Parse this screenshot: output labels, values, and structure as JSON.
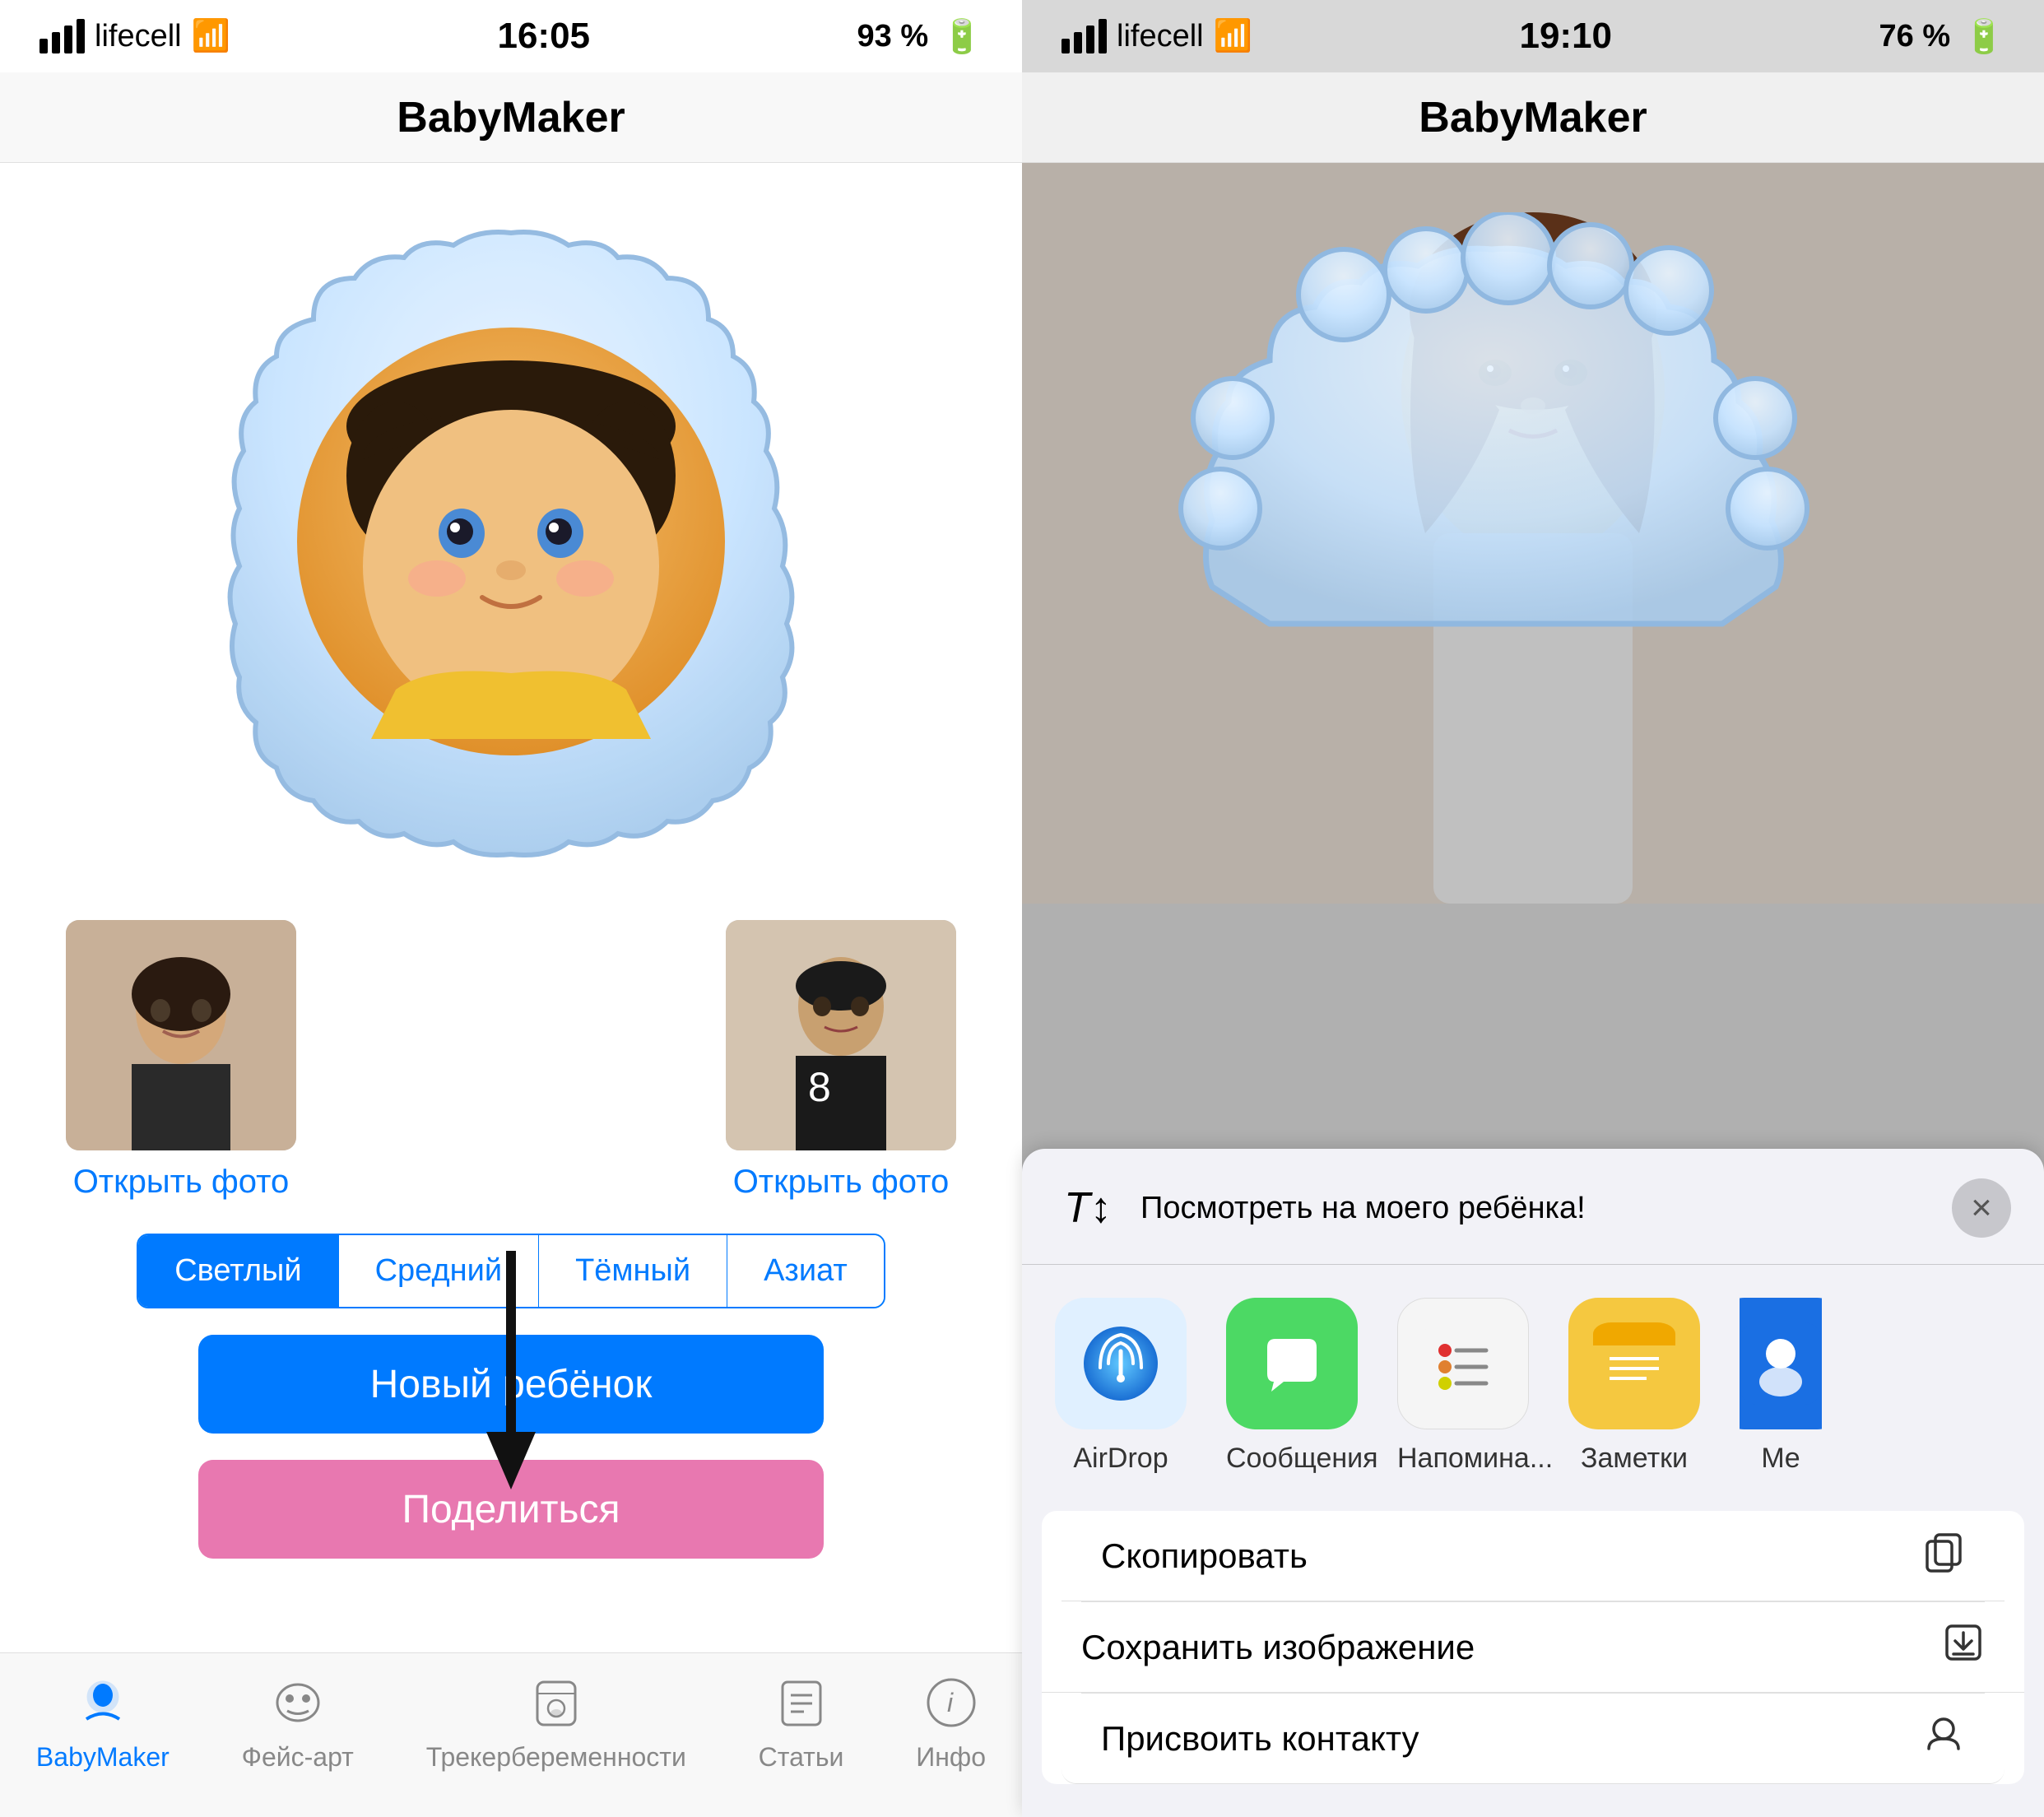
{
  "left": {
    "status": {
      "carrier": "lifecell",
      "time": "16:05",
      "battery": "93 %",
      "signal": 4,
      "wifi": true
    },
    "nav": {
      "title": "BabyMaker"
    },
    "skin_buttons": [
      {
        "label": "Светлый",
        "active": true
      },
      {
        "label": "Средний",
        "active": false
      },
      {
        "label": "Тёмный",
        "active": false
      },
      {
        "label": "Азиат",
        "active": false
      }
    ],
    "btn_new": "Новый ребёнок",
    "btn_share": "Поделиться",
    "open_photo_left": "Открыть фото",
    "open_photo_right": "Открыть фото",
    "tabs": [
      {
        "label": "BabyMaker",
        "active": true
      },
      {
        "label": "Фейс-арт",
        "active": false
      },
      {
        "label": "Трекербеременности",
        "active": false
      },
      {
        "label": "Статьи",
        "active": false
      },
      {
        "label": "Инфо",
        "active": false
      }
    ]
  },
  "right": {
    "status": {
      "carrier": "lifecell",
      "time": "19:10",
      "battery": "76 %",
      "signal": 4,
      "wifi": true
    },
    "nav": {
      "title": "BabyMaker"
    },
    "share_sheet": {
      "message": "Посмотреть на моего ребёнка!",
      "close_label": "×",
      "apps": [
        {
          "name": "AirDrop",
          "color": "#1a8fe3"
        },
        {
          "name": "Сообщения",
          "color": "#4cd964"
        },
        {
          "name": "Напомина...",
          "color": "#f5f5f5"
        },
        {
          "name": "Заметки",
          "color": "#f5c842"
        },
        {
          "name": "Me",
          "color": "#1a6fe3"
        }
      ],
      "actions": [
        {
          "label": "Скопировать",
          "icon": "⊞"
        },
        {
          "label": "Сохранить изображение",
          "icon": "⬇"
        },
        {
          "label": "Присвоить контакту",
          "icon": "👤"
        }
      ]
    }
  }
}
